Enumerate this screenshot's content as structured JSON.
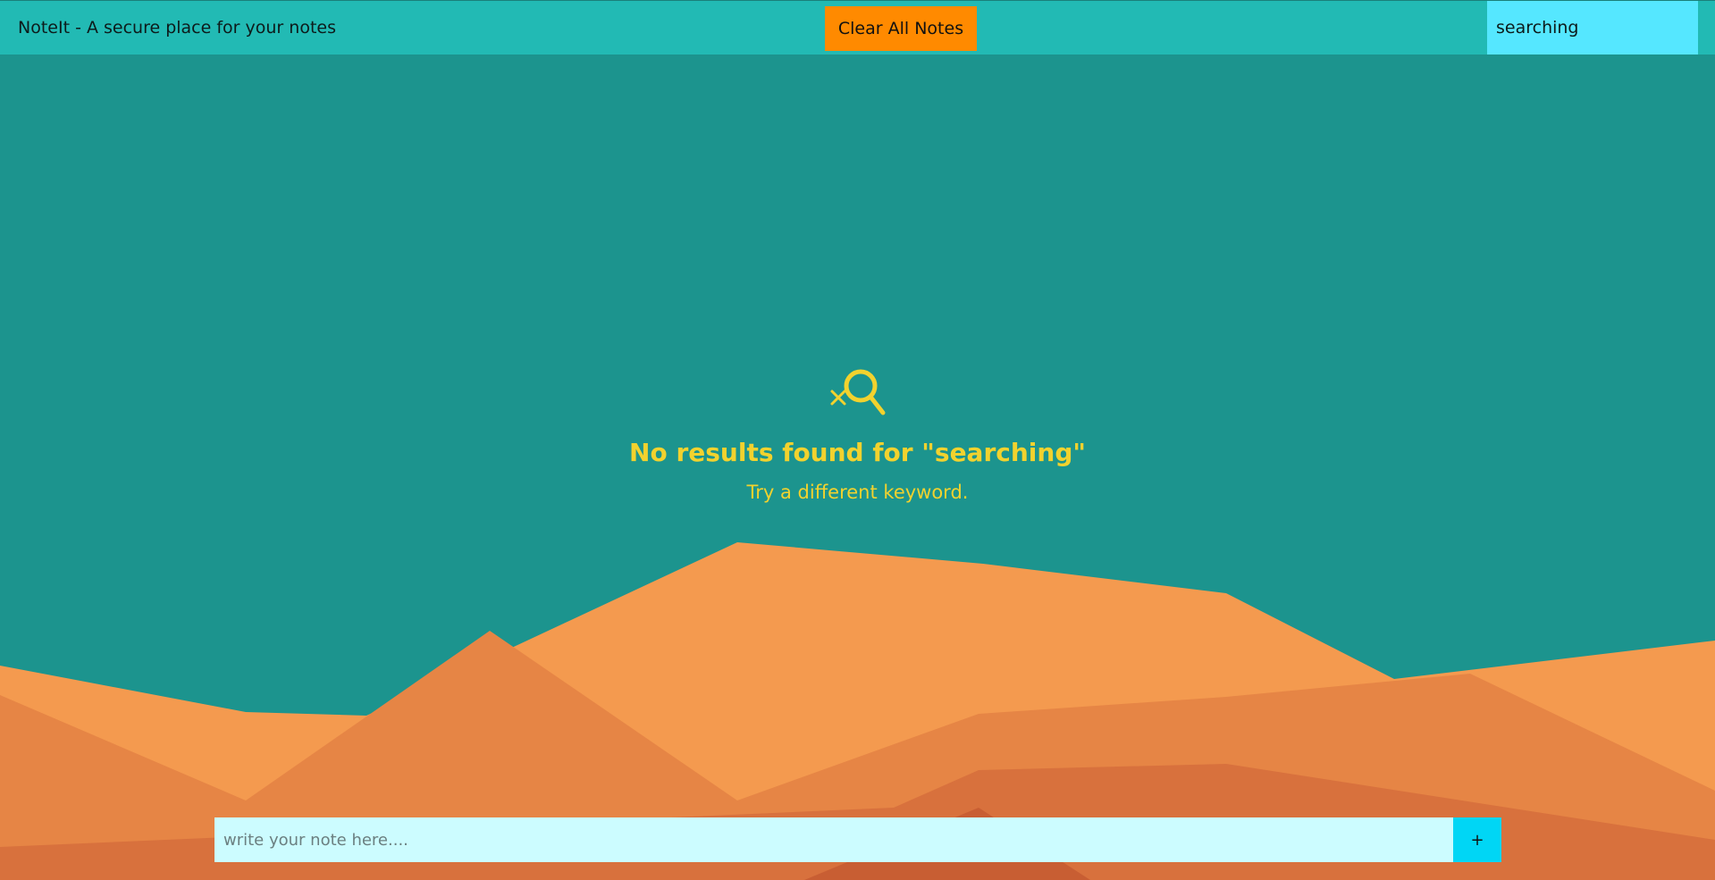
{
  "header": {
    "app_title": "NoteIt - A secure place for your notes",
    "clear_button_label": "Clear All Notes",
    "search_value": "searching"
  },
  "empty_state": {
    "icon": "search-no-results-icon",
    "title": "No results found for \"searching\"",
    "subtitle": "Try a different keyword."
  },
  "composer": {
    "placeholder": "write your note here....",
    "add_button_label": "+"
  },
  "colors": {
    "background": "#1c948e",
    "topbar": "#22bab4",
    "clear_button": "#ff8a00",
    "search_field": "#55e7ff",
    "empty_state_text": "#f2d22e",
    "note_input": "#ccfcff",
    "add_button": "#00d6f5"
  }
}
